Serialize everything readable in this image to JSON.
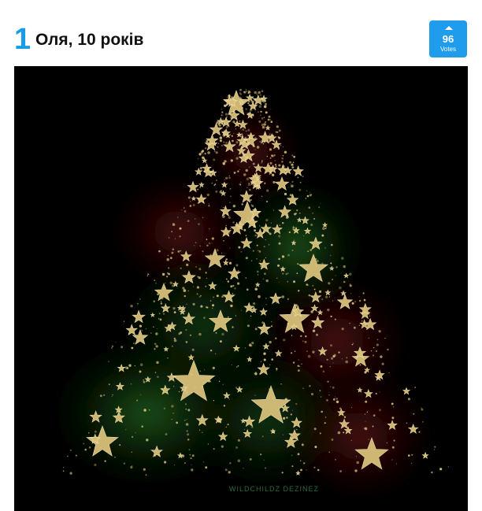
{
  "entry": {
    "rank": "1",
    "title": "Оля, 10 років",
    "votes": {
      "count": "96",
      "label": "Votes",
      "icon": "arrow-up-icon"
    },
    "image": {
      "watermark": "WILDCHILDZ DEZINEZ"
    }
  },
  "colors": {
    "accent": "#1f9cec",
    "rank": "#1a9be8",
    "image_background": "#000000",
    "star_gold": "#d8c07a"
  }
}
